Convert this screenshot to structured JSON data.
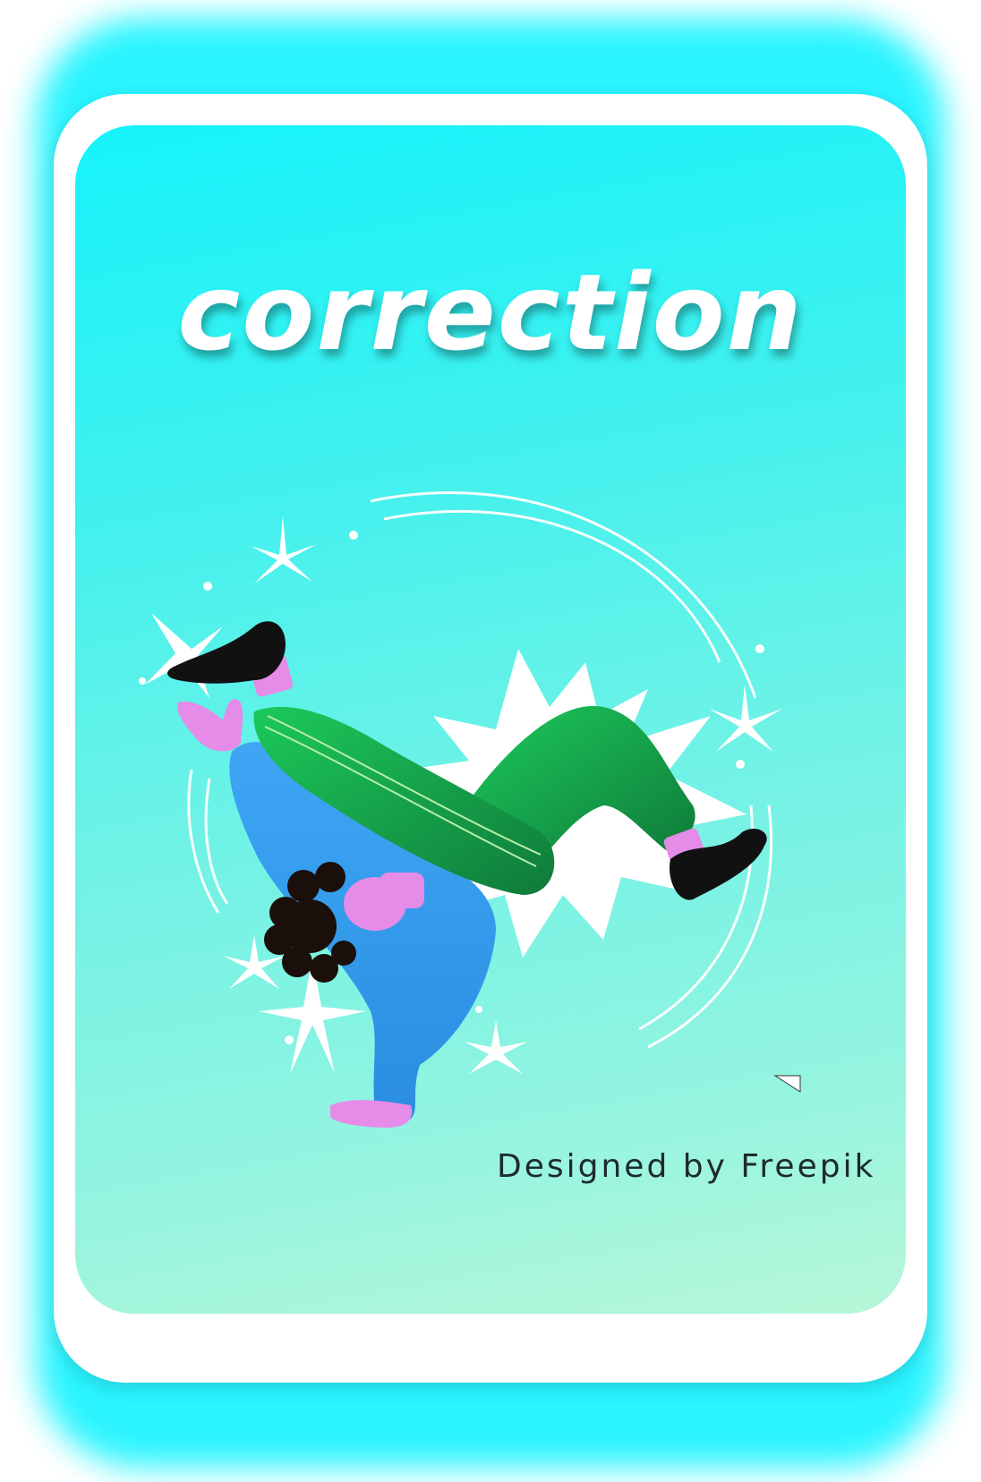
{
  "card": {
    "title": "correction",
    "credit": "Designed by Freepik"
  },
  "illustration": {
    "subject": "breakdancer-freeze",
    "colors": {
      "background_top": "#15f3fb",
      "background_bottom": "#b7f7d8",
      "glow": "#1ef4ff",
      "pants": "#17a64a",
      "jacket": "#2f9ef0",
      "skin": "#e58be8",
      "shoes": "#111111",
      "burst": "#ffffff"
    }
  }
}
